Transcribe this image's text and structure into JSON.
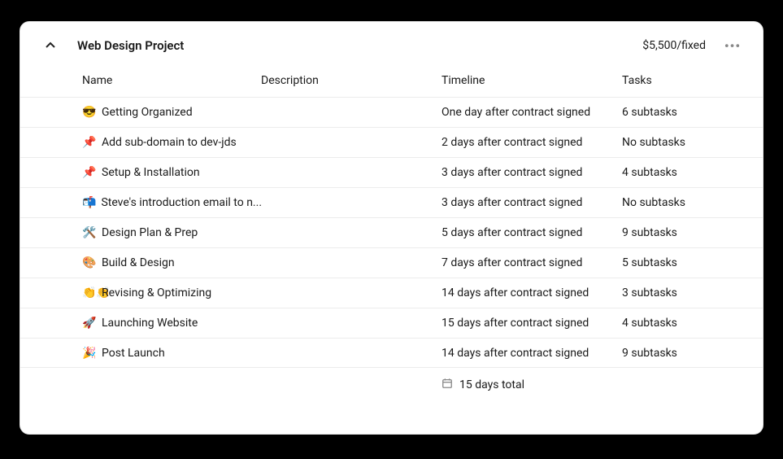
{
  "project": {
    "title": "Web Design Project",
    "price": "$5,500/fixed"
  },
  "columns": {
    "name": "Name",
    "description": "Description",
    "timeline": "Timeline",
    "tasks": "Tasks"
  },
  "rows": [
    {
      "emoji": "😎",
      "name": "Getting Organized",
      "description": "",
      "timeline": "One day after contract signed",
      "tasks": "6 subtasks"
    },
    {
      "emoji": "📌",
      "name": "Add sub-domain to dev-jds",
      "description": "",
      "timeline": "2 days after contract signed",
      "tasks": "No subtasks"
    },
    {
      "emoji": "📌",
      "name": "Setup & Installation",
      "description": "",
      "timeline": "3 days after contract signed",
      "tasks": "4 subtasks"
    },
    {
      "emoji": "📬",
      "name": "Steve's introduction email to n...",
      "description": "",
      "timeline": "3 days after contract signed",
      "tasks": "No subtasks"
    },
    {
      "emoji": "🛠️",
      "name": "Design Plan & Prep",
      "description": "",
      "timeline": "5 days after contract signed",
      "tasks": "9 subtasks"
    },
    {
      "emoji": "🎨",
      "name": "Build & Design",
      "description": "",
      "timeline": "7 days after contract signed",
      "tasks": "5 subtasks"
    },
    {
      "emoji": "👏👏",
      "name": "Revising & Optimizing",
      "description": "",
      "timeline": "14 days after contract signed",
      "tasks": "3 subtasks"
    },
    {
      "emoji": "🚀",
      "name": "Launching Website",
      "description": "",
      "timeline": "15 days after contract signed",
      "tasks": "4 subtasks"
    },
    {
      "emoji": "🎉",
      "name": "Post Launch",
      "description": "",
      "timeline": "14 days after contract signed",
      "tasks": "9 subtasks"
    }
  ],
  "footer": {
    "total": "15 days total"
  }
}
